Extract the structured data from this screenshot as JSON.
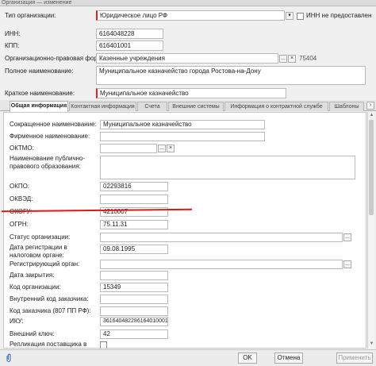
{
  "window": {
    "title": "Организация — изменение"
  },
  "header": {
    "org_type_label": "Тип организации:",
    "org_type_value": "Юридическое лицо РФ",
    "inn_missing_label": "ИНН не предоставлен",
    "inn_label": "ИНН:",
    "inn_value": "6164048228",
    "kpp_label": "КПП:",
    "kpp_value": "616401001",
    "opf_label": "Организационно-правовая форма:",
    "opf_value": "Казенные учреждения",
    "opf_code": "75404",
    "full_name_label": "Полное наименование:",
    "full_name_value": "Муниципальное казначейство города Ростова-на-Дону",
    "short_name_label": "Краткое наименование:",
    "short_name_value": "Муниципальное казначейство"
  },
  "tabs": [
    "Общая информация",
    "Контактная информация",
    "Счета",
    "Внешние системы",
    "Информация о контрактной службе",
    "Шаблоны"
  ],
  "general": {
    "short_name_label": "Сокращенное наименование:",
    "short_name_value": "Муниципальное казначейство",
    "brand_name_label": "Фирменное наименование:",
    "brand_name_value": "",
    "oktmo_label": "ОКТМО:",
    "oktmo_value": "",
    "pub_entity_label": "Наименование публично-правового образования:",
    "pub_entity_value": "",
    "okpo_label": "ОКПО:",
    "okpo_value": "02293816",
    "okved_label": "ОКВЭД:",
    "okved_value": "",
    "okogu_label": "ОКОГУ:",
    "okogu_value": "4210007",
    "ogrn_label": "ОГРН:",
    "ogrn_value": "75.11.31",
    "status_label": "Статус организации:",
    "status_value": "",
    "reg_date_label": "Дата регистрации в налоговом органе:",
    "reg_date_value": "09.08.1995",
    "reg_body_label": "Регистрирующий орган:",
    "reg_body_value": "",
    "close_date_label": "Дата закрытия:",
    "close_date_value": "",
    "org_code_label": "Код организации:",
    "org_code_value": "15349",
    "internal_code_label": "Внутренний код заказчика:",
    "internal_code_value": "",
    "customer_code_label": "Код заказчика (807 ПП РФ):",
    "customer_code_value": "",
    "iku_label": "ИКУ:",
    "iku_value": "361640482286164010001",
    "ext_key_label": "Внешний ключ:",
    "ext_key_value": "42",
    "replication_label": "Репликация поставщика в АИС ГЗ:"
  },
  "footer": {
    "ok": "OK",
    "cancel": "Отмена",
    "apply": "Применить"
  },
  "icons": {
    "ellipsis": "...",
    "clear": "×",
    "attach": "paperclip-icon"
  },
  "colors": {
    "required": "#d22222",
    "annotation": "#e01818"
  }
}
